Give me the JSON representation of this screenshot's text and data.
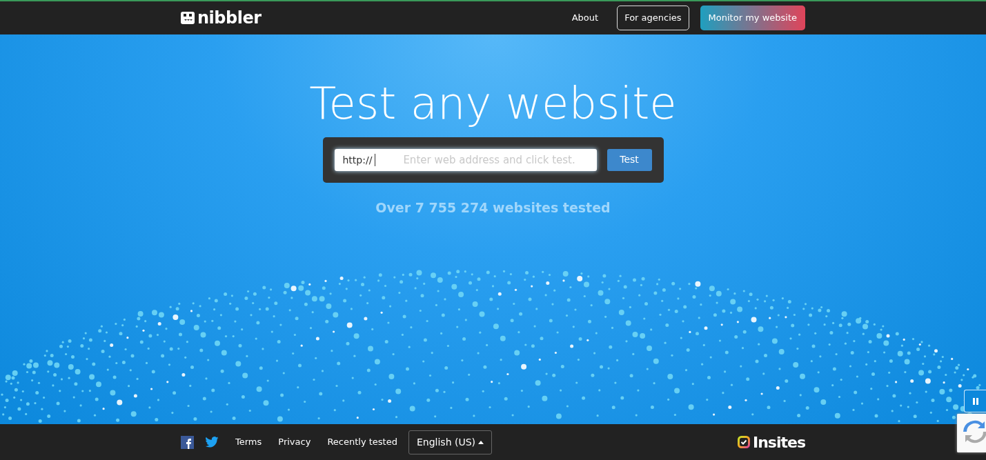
{
  "navbar": {
    "brand": "nibbler",
    "links": [
      {
        "label": "About",
        "kind": "link"
      },
      {
        "label": "For agencies",
        "kind": "outline"
      },
      {
        "label": "Monitor my website",
        "kind": "gradient"
      }
    ]
  },
  "hero": {
    "title": "Test any website",
    "search": {
      "prefix": "http://",
      "placeholder": "Enter web address and click test.",
      "button": "Test"
    },
    "stat": "Over 7 755 274 websites tested"
  },
  "footer": {
    "links": [
      "Terms",
      "Privacy",
      "Recently tested"
    ],
    "language": "English (US)",
    "partner": "Insites"
  }
}
